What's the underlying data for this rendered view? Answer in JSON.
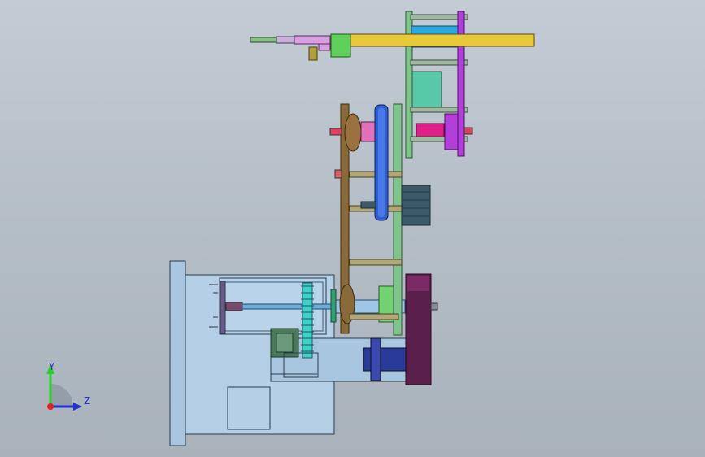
{
  "window": {
    "background_top": "#c3cbd4",
    "background_bottom": "#a9b2bb"
  },
  "model": {
    "view": "front",
    "components": [
      "base-frame",
      "motor-housing",
      "drive-shaft",
      "spur-gear",
      "coupling",
      "gearbox",
      "lower-bracket",
      "left-arm-plate",
      "right-arm-plate",
      "upper-pulley",
      "timing-belt",
      "servo-motor",
      "upper-frame",
      "magenta-side-plate",
      "gripper-rail",
      "gripper-head"
    ],
    "colors": {
      "base": "#a9c6e0",
      "rail": "#e8c93a",
      "arm_left": "#8b6a3a",
      "arm_right": "#7fc48a",
      "belt": "#2e5fd0",
      "motor": "#3d5a6a",
      "plate_purple": "#b040d8",
      "bracket": "#5a1f4a",
      "gear": "#30c8c0",
      "gripper": "#5fd05a"
    }
  },
  "triad": {
    "y_label": "Y",
    "z_label": "Z",
    "y_color": "#2ad12a",
    "z_color": "#2233cc",
    "origin_color": "#e02020"
  }
}
